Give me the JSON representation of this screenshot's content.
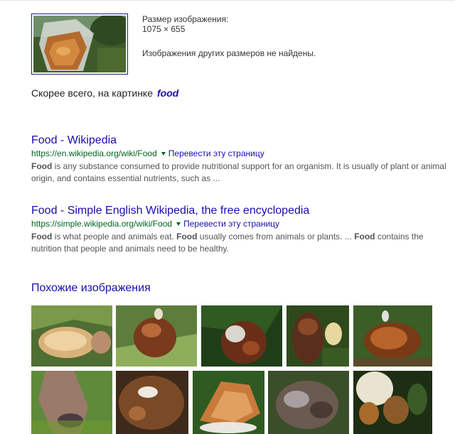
{
  "image_info": {
    "size_label": "Размер изображения:",
    "size_value": "1075 × 655",
    "no_other_sizes": "Изображения других размеров не найдены."
  },
  "best_guess": {
    "prefix": "Скорее всего, на картинке",
    "query": "food"
  },
  "results": [
    {
      "title": "Food - Wikipedia",
      "url": "https://en.wikipedia.org/wiki/Food",
      "translate": "Перевести эту страницу",
      "snippet_parts": [
        {
          "b": "Food"
        },
        {
          "t": " is any substance consumed to provide nutritional support for an organism. It is usually of plant or animal origin, and contains essential nutrients, such as ..."
        }
      ]
    },
    {
      "title": "Food - Simple English Wikipedia, the free encyclopedia",
      "url": "https://simple.wikipedia.org/wiki/Food",
      "translate": "Перевести эту страницу",
      "snippet_parts": [
        {
          "b": "Food"
        },
        {
          "t": " is what people and animals eat. "
        },
        {
          "b": "Food"
        },
        {
          "t": " usually comes from animals or plants. ... "
        },
        {
          "b": "Food"
        },
        {
          "t": " contains the nutrition that people and animals need to be healthy."
        }
      ]
    }
  ],
  "similar": {
    "title": "Похожие изображения"
  },
  "colors": {
    "link": "#1a0dab",
    "url_green": "#006621",
    "snippet": "#545454"
  }
}
